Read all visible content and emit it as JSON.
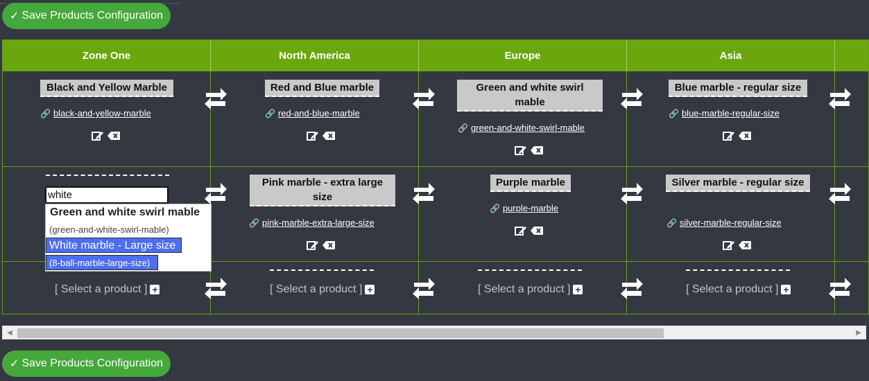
{
  "save_label": "Save Products Configuration",
  "save_check": "✓",
  "zones": [
    "Zone One",
    "North America",
    "Europe",
    "Asia"
  ],
  "rows": [
    [
      {
        "name": "Black and Yellow Marble",
        "slug": "black-and-yellow-marble"
      },
      {
        "name": "Red and Blue marble",
        "slug": "red-and-blue-marble"
      },
      {
        "name": "Green and white swirl mable",
        "slug": "green-and-white-swirl-mable"
      },
      {
        "name": "Blue marble - regular size",
        "slug": "blue-marble-regular-size"
      }
    ],
    [
      {
        "search_value": "white"
      },
      {
        "name": "Pink marble - extra large size",
        "slug": "pink-marble-extra-large-size"
      },
      {
        "name": "Purple marble",
        "slug": "purple-marble"
      },
      {
        "name": "Silver marble - regular size",
        "slug": "silver-marble-regular-size"
      }
    ],
    [
      {
        "select_label": "[ Select a product ]"
      },
      {
        "select_label": "[ Select a product ]"
      },
      {
        "select_label": "[ Select a product ]"
      },
      {
        "select_label": "[ Select a product ]"
      }
    ]
  ],
  "autocomplete": [
    {
      "name": "Green and white swirl mable",
      "slug": "(green-and-white-swirl-mable)",
      "highlighted": false
    },
    {
      "name": "White marble - Large size",
      "slug": "(8-ball-marble-large-size)",
      "highlighted": true
    }
  ],
  "icons": {
    "link": "link-icon",
    "edit": "edit-icon",
    "delete": "delete-icon",
    "swap": "swap-arrows-icon",
    "add": "plus-icon"
  },
  "colors": {
    "background": "#343841",
    "header": "#6aa70c",
    "save_button": "#45a83a",
    "highlight": "#4d6ef0"
  }
}
